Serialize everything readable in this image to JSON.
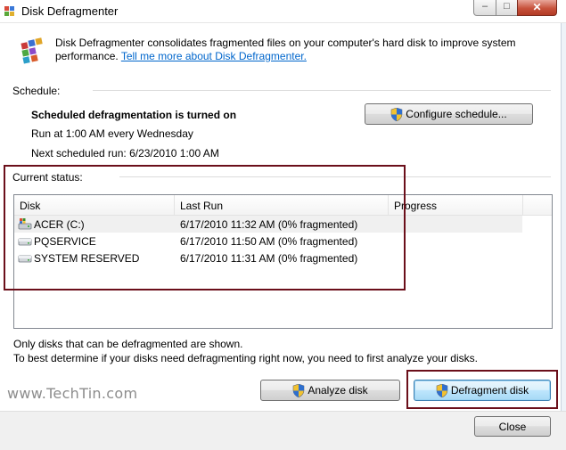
{
  "window": {
    "title": "Disk Defragmenter",
    "minimize_glyph": "–",
    "maximize_glyph": "□",
    "close_glyph": "✕"
  },
  "header": {
    "description": "Disk Defragmenter consolidates fragmented files on your computer's hard disk to improve system performance.",
    "link_text": "Tell me more about Disk Defragmenter."
  },
  "schedule": {
    "label": "Schedule:",
    "status": "Scheduled defragmentation is turned on",
    "run_at": "Run at 1:00 AM every Wednesday",
    "next_run": "Next scheduled run: 6/23/2010 1:00 AM",
    "configure_button": "Configure schedule..."
  },
  "current_status": {
    "label": "Current status:",
    "columns": [
      "Disk",
      "Last Run",
      "Progress"
    ],
    "disks": [
      {
        "name": "ACER (C:)",
        "last_run": "6/17/2010 11:32 AM (0% fragmented)",
        "progress": "",
        "icon": "system-drive-icon"
      },
      {
        "name": "PQSERVICE",
        "last_run": "6/17/2010 11:50 AM (0% fragmented)",
        "progress": "",
        "icon": "drive-icon"
      },
      {
        "name": "SYSTEM RESERVED",
        "last_run": "6/17/2010 11:31 AM (0% fragmented)",
        "progress": "",
        "icon": "drive-icon"
      }
    ]
  },
  "notes": {
    "line1": "Only disks that can be defragmented are shown.",
    "line2": "To best determine if your disks need defragmenting right now, you need to first analyze your disks."
  },
  "actions": {
    "analyze_button": "Analyze disk",
    "defragment_button": "Defragment disk",
    "close_button": "Close"
  },
  "watermark": "www.TechTin.com",
  "colors": {
    "link": "#0066cc",
    "highlight": "#6b0f1a",
    "focus_button": "#bee6fd"
  }
}
